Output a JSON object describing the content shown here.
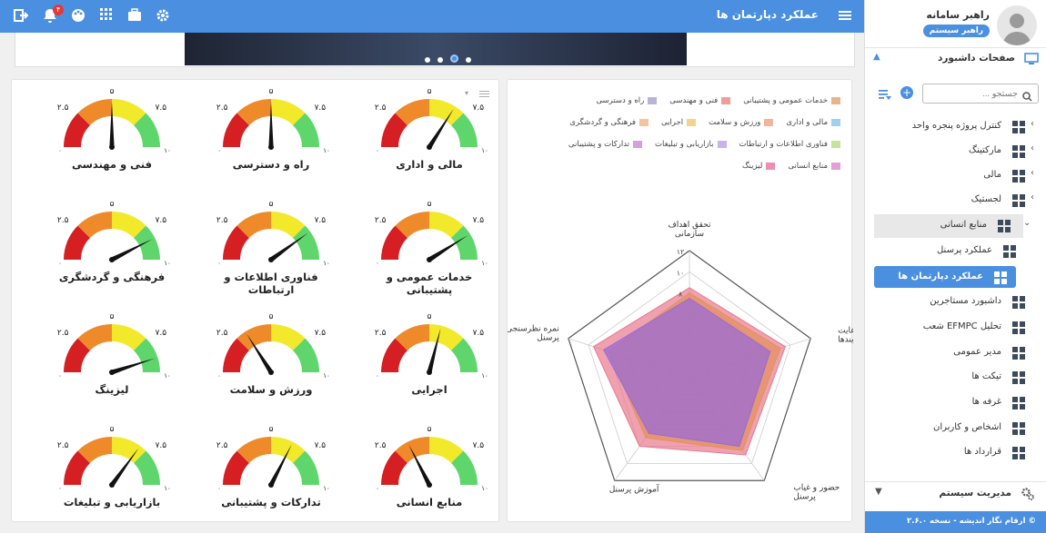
{
  "header": {
    "title": "عملکرد دپارتمان ها",
    "notification_count": "۴"
  },
  "user": {
    "name": "راهبر سامانه",
    "role": "راهبر سیستم"
  },
  "sidebar": {
    "section_title": "صفحات داشبورد",
    "search_placeholder": "جستجو ...",
    "items": [
      {
        "label": "کنترل پروژه پنجره واحد"
      },
      {
        "label": "مارکتینگ"
      },
      {
        "label": "مالی"
      },
      {
        "label": "لجستیک"
      },
      {
        "label": "منابع انسانی"
      },
      {
        "label": "عملکرد پرسنل"
      },
      {
        "label": "عملکرد دپارتمان ها"
      },
      {
        "label": "داشبورد مستاجرین"
      },
      {
        "label": "تحلیل EFMPC شعب"
      },
      {
        "label": "مدیر عمومی"
      },
      {
        "label": "تیکت ها"
      },
      {
        "label": "غرفه ها"
      },
      {
        "label": "اشخاص و کاربران"
      },
      {
        "label": "قرارداد ها"
      }
    ],
    "system_management": "مدیریت سیستم",
    "footer": "© ارقام نگار اندیشه - نسخه ۲.۶.۰"
  },
  "gauges": [
    {
      "label": "مالی و اداری",
      "value": 6.8
    },
    {
      "label": "راه و دسترسی",
      "value": 5.0
    },
    {
      "label": "فنی و مهندسی",
      "value": 5.0
    },
    {
      "label": "خدمات عمومی و پشتیبانی",
      "value": 8.2
    },
    {
      "label": "فناوری اطلاعات و ارتباطات",
      "value": 8.0
    },
    {
      "label": "فرهنگی و گردشگری",
      "value": 8.5
    },
    {
      "label": "اجرایی",
      "value": 5.8
    },
    {
      "label": "ورزش و سلامت",
      "value": 3.2
    },
    {
      "label": "لیزینگ",
      "value": 9.0
    },
    {
      "label": "منابع انسانی",
      "value": 3.5
    },
    {
      "label": "تدارکات و پشتیبانی",
      "value": 6.5
    },
    {
      "label": "بازاریابی و تبلیغات",
      "value": 7.0
    }
  ],
  "gauge_ticks": {
    "min": "۰",
    "q1": "۲.۵",
    "mid": "۵",
    "q3": "۷.۵",
    "max": "۱۰"
  },
  "chart_data": {
    "type": "radar",
    "axes": [
      "تحقق اهداف سازمانی",
      "رعایت فرآیندها",
      "حضور و غیاب پرسنل",
      "آموزش پرسنل",
      "نمره نظرسنجی پرسنل"
    ],
    "tick_labels": [
      "۸",
      "۱۰",
      "۱۲"
    ],
    "legend": [
      {
        "name": "خدمات عمومی و پشتیبانی",
        "color": "#e8b58a"
      },
      {
        "name": "فنی و مهندسی",
        "color": "#f29b9b"
      },
      {
        "name": "راه و دسترسی",
        "color": "#b7b4d8"
      },
      {
        "name": "مالی و اداری",
        "color": "#9fd0ef"
      },
      {
        "name": "ورزش و سلامت",
        "color": "#f2b59b"
      },
      {
        "name": "اجرایی",
        "color": "#f3d48a"
      },
      {
        "name": "فرهنگی و گردشگری",
        "color": "#f5c49b"
      },
      {
        "name": "فناوری اطلاعات و ارتباطات",
        "color": "#c5e39b"
      },
      {
        "name": "بازاریابی و تبلیغات",
        "color": "#c9b3ef"
      },
      {
        "name": "تدارکات و پشتیبانی",
        "color": "#d89de3"
      },
      {
        "name": "منابع انسانی",
        "color": "#e59ed6"
      },
      {
        "name": "لیزینگ",
        "color": "#ef8fb0"
      }
    ],
    "series": [
      {
        "name": "لیزینگ",
        "color": "#e8798f",
        "values": [
          8.5,
          9.5,
          9.0,
          8.0,
          9.5
        ]
      },
      {
        "name": "خدمات عمومی و پشتیبانی",
        "color": "#e2925b",
        "values": [
          8.0,
          9.0,
          8.5,
          7.0,
          8.0
        ]
      },
      {
        "name": "بازاریابی و تبلیغات",
        "color": "#9a6bd6",
        "values": [
          7.5,
          8.0,
          8.0,
          6.5,
          8.5
        ]
      }
    ]
  }
}
